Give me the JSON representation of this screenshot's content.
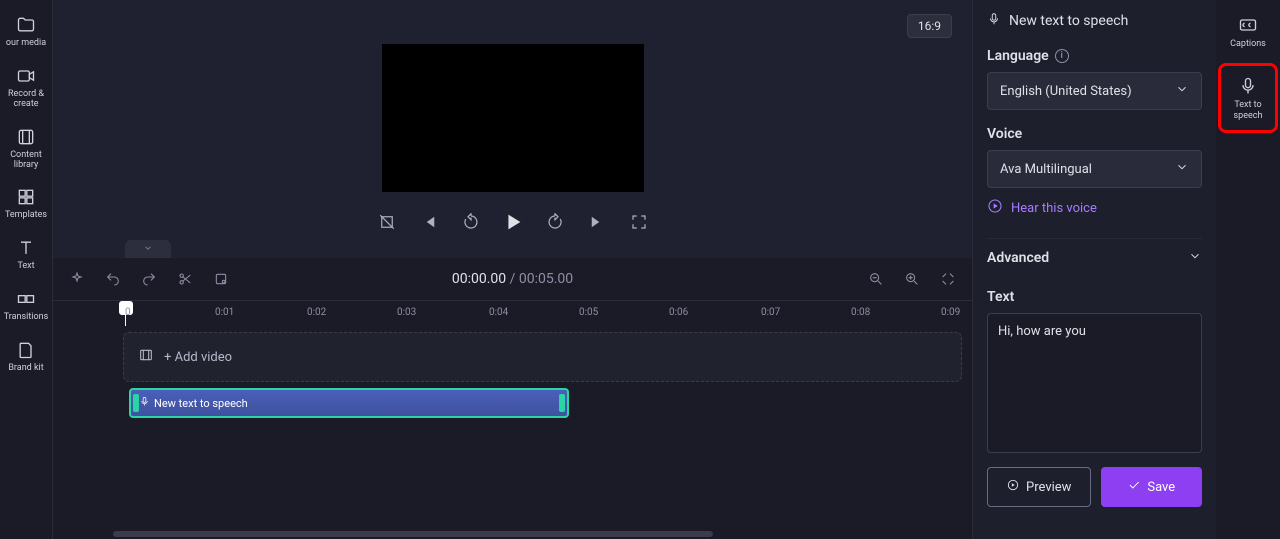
{
  "leftSidebar": [
    "our media",
    "Record & create",
    "Content library",
    "Templates",
    "Text",
    "Transitions",
    "Brand kit"
  ],
  "aspectRatio": "16:9",
  "time": {
    "current": "00:00.00",
    "duration": "00:05.00"
  },
  "ruler": [
    "0",
    "0:01",
    "0:02",
    "0:03",
    "0:04",
    "0:05",
    "0:06",
    "0:07",
    "0:08",
    "0:09"
  ],
  "addVideo": "+ Add video",
  "clipLabel": "New text to speech",
  "panel": {
    "title": "New text to speech",
    "languageLabel": "Language",
    "language": "English (United States)",
    "voiceLabel": "Voice",
    "voice": "Ava Multilingual",
    "hear": "Hear this voice",
    "advanced": "Advanced",
    "textLabel": "Text",
    "textValue": "Hi, how are you",
    "previewBtn": "Preview",
    "saveBtn": "Save"
  },
  "farRight": {
    "captions": "Captions",
    "tts": "Text to speech"
  }
}
